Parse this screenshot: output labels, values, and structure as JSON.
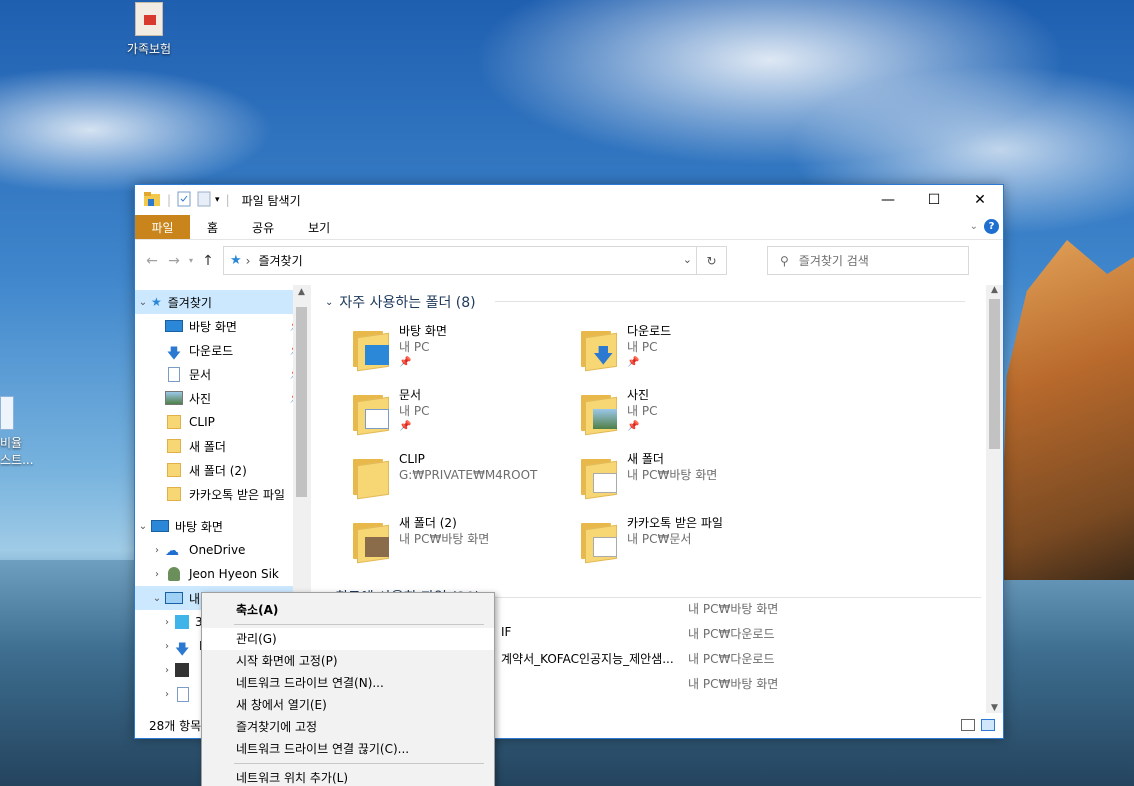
{
  "desktop": {
    "icon_family_insurance": "가족보험",
    "icon_partial_line1": "비율",
    "icon_partial_line2": "스트..."
  },
  "window": {
    "title": "파일 탐색기",
    "controls": {
      "minimize": "—",
      "maximize": "☐",
      "close": "✕"
    },
    "ribbon_tabs": [
      "파일",
      "홈",
      "공유",
      "보기"
    ],
    "address_crumb": "즐겨찾기",
    "search_placeholder": "즐겨찾기 검색",
    "status": "28개 항목"
  },
  "nav_pane": {
    "quick_access": "즐겨찾기",
    "items": [
      {
        "label": "바탕 화면",
        "icon": "desktop-icon",
        "pinned": true
      },
      {
        "label": "다운로드",
        "icon": "download-icon",
        "pinned": true
      },
      {
        "label": "문서",
        "icon": "document-icon",
        "pinned": true
      },
      {
        "label": "사진",
        "icon": "pictures-icon",
        "pinned": true
      },
      {
        "label": "CLIP",
        "icon": "folder-icon",
        "pinned": false
      },
      {
        "label": "새 폴더",
        "icon": "folder-icon",
        "pinned": false
      },
      {
        "label": "새 폴더 (2)",
        "icon": "folder-icon",
        "pinned": false
      },
      {
        "label": "카카오톡 받은 파일",
        "icon": "folder-icon",
        "pinned": false
      }
    ],
    "desktop": "바탕 화면",
    "onedrive": "OneDrive",
    "user": "Jeon Hyeon Sik",
    "this_pc": "내 PC",
    "sub_3": "3",
    "sub_d": "D"
  },
  "content": {
    "frequent_header": "자주 사용하는 폴더 (8)",
    "recent_header": "최근에 사용한 파일 (20)",
    "tiles": [
      {
        "name": "바탕 화면",
        "location": "내 PC",
        "pinned": true
      },
      {
        "name": "다운로드",
        "location": "내 PC",
        "pinned": true
      },
      {
        "name": "문서",
        "location": "내 PC",
        "pinned": true
      },
      {
        "name": "사진",
        "location": "내 PC",
        "pinned": true
      },
      {
        "name": "CLIP",
        "location": "G:₩PRIVATE₩M4ROOT",
        "pinned": false
      },
      {
        "name": "새 폴더",
        "location": "내 PC₩바탕 화면",
        "pinned": false
      },
      {
        "name": "새 폴더 (2)",
        "location": "내 PC₩바탕 화면",
        "pinned": false
      },
      {
        "name": "카카오톡 받은 파일",
        "location": "내 PC₩문서",
        "pinned": false
      }
    ],
    "recent_files": [
      {
        "name": "",
        "path": "내 PC₩바탕 화면"
      },
      {
        "name": "IF",
        "path": "내 PC₩다운로드"
      },
      {
        "name": "계약서_KOFAC인공지능_제안샘...",
        "path": "내 PC₩다운로드"
      },
      {
        "name": "",
        "path": "내 PC₩바탕 화면"
      }
    ]
  },
  "context_menu": {
    "items": [
      {
        "label": "축소(A)",
        "bold": true
      },
      {
        "separator": true
      },
      {
        "label": "관리(G)"
      },
      {
        "label": "시작 화면에 고정(P)"
      },
      {
        "label": "네트워크 드라이브 연결(N)..."
      },
      {
        "label": "새 창에서 열기(E)"
      },
      {
        "label": "즐겨찾기에 고정"
      },
      {
        "label": "네트워크 드라이브 연결 끊기(C)..."
      },
      {
        "separator": true
      },
      {
        "label": "네트워크 위치 추가(L)"
      }
    ]
  },
  "colors": {
    "accent": "#2b79d1",
    "file_tab": "#c9851c",
    "selection": "#cce8ff",
    "folder": "#f7d674"
  }
}
